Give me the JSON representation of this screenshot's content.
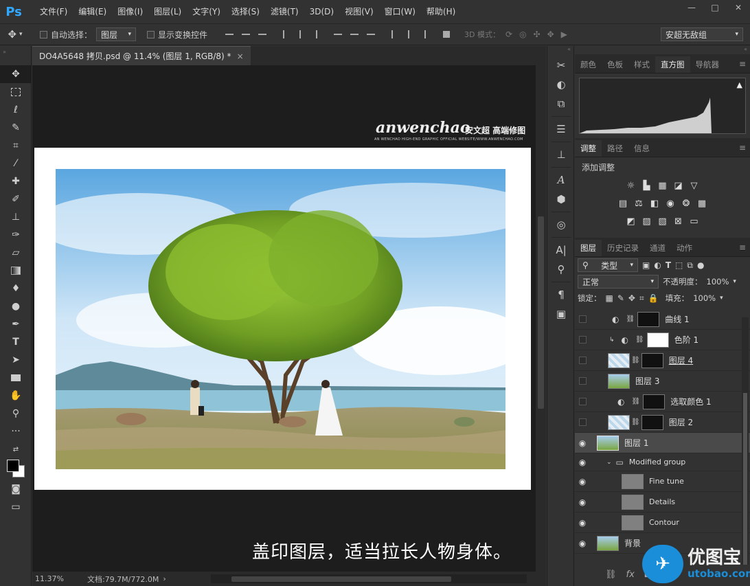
{
  "app": {
    "logo": "Ps"
  },
  "menu": [
    "文件(F)",
    "编辑(E)",
    "图像(I)",
    "图层(L)",
    "文字(Y)",
    "选择(S)",
    "滤镜(T)",
    "3D(D)",
    "视图(V)",
    "窗口(W)",
    "帮助(H)"
  ],
  "window_controls": {
    "min": "—",
    "max": "□",
    "close": "✕"
  },
  "options": {
    "auto_select_label": "自动选择：",
    "auto_select_value": "图层",
    "show_transform_label": "显示变换控件",
    "mode_3d_label": "3D 模式：",
    "workspace_value": "安超无敌组"
  },
  "document": {
    "tab_title": "DO4A5648 拷贝.psd @ 11.4% (图层 1, RGB/8) *",
    "tab_close": "×",
    "zoom": "11.37%",
    "doc_size": "文档:79.7M/772.0M"
  },
  "watermark": {
    "brand": "anwenchao",
    "brand_cn": "安文超 高端修图",
    "subline": "AN WENCHAO HIGH-END GRAPHIC OFFICIAL WEBSITE/WWW.ANWENCHAO.COM"
  },
  "caption": "盖印图层，适当拉长人物身体。",
  "panels": {
    "top_tabs": [
      "颜色",
      "色板",
      "样式",
      "直方图",
      "导航器"
    ],
    "adj_tabs": [
      "调整",
      "路径",
      "信息"
    ],
    "adj_title": "添加调整",
    "layer_tabs": [
      "图层",
      "历史记录",
      "通道",
      "动作"
    ],
    "filter_kind": "类型",
    "blend_mode": "正常",
    "opacity_label": "不透明度：",
    "opacity_value": "100%",
    "lock_label": "锁定：",
    "fill_label": "填充：",
    "fill_value": "100%"
  },
  "layers": [
    {
      "name": "曲线 1",
      "visible": false
    },
    {
      "name": "色阶 1",
      "visible": false
    },
    {
      "name": "图层 4",
      "visible": false
    },
    {
      "name": "图层 3",
      "visible": false
    },
    {
      "name": "选取颜色 1",
      "visible": false
    },
    {
      "name": "图层 2",
      "visible": false
    },
    {
      "name": "图层 1",
      "visible": true
    },
    {
      "name": "Modified group",
      "visible": true
    },
    {
      "name": "Fine tune",
      "visible": true
    },
    {
      "name": "Details",
      "visible": true
    },
    {
      "name": "Contour",
      "visible": true
    },
    {
      "name": "背景",
      "visible": true
    }
  ],
  "site_logo": {
    "name": "优图宝",
    "url": "utobao.com"
  },
  "colors": {
    "accent": "#31a8ff",
    "logo_blue": "#1a8ed9"
  }
}
